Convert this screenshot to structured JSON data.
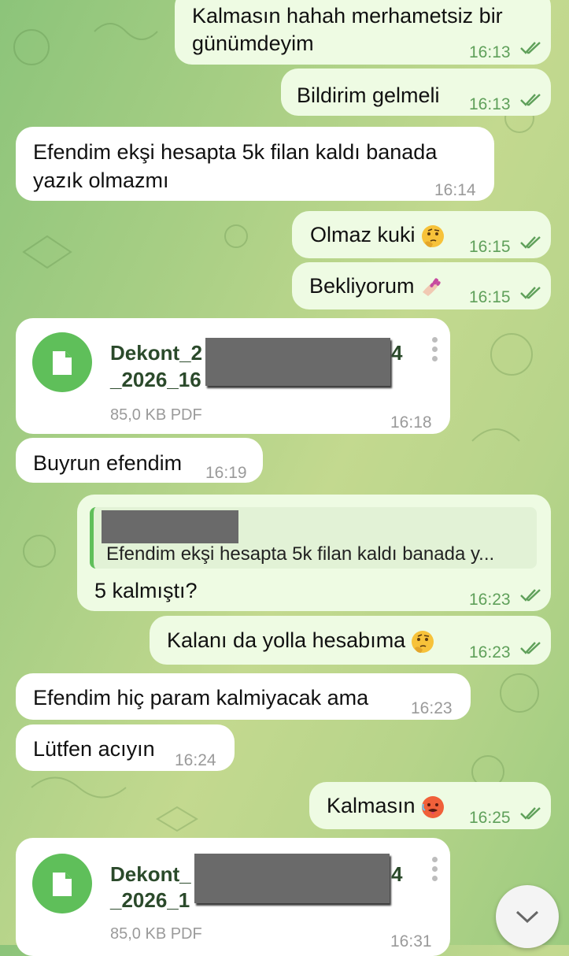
{
  "colors": {
    "outgoing_bubble": "#eefbe3",
    "incoming_bubble": "#ffffff",
    "accent": "#5fbf5a"
  },
  "messages": [
    {
      "dir": "out",
      "lines": [
        "Kalmasın hahah merhametsiz bir",
        "günümdeyim"
      ],
      "time": "16:13",
      "read": true
    },
    {
      "dir": "out",
      "lines": [
        "Bildirim gelmeli"
      ],
      "time": "16:13",
      "read": true
    },
    {
      "dir": "in",
      "lines": [
        "Efendim ekşi hesapta 5k filan kaldı banada",
        "yazık olmazmı"
      ],
      "time": "16:14"
    },
    {
      "dir": "out",
      "lines": [
        "Olmaz kuki"
      ],
      "emoji": "thinking-face",
      "time": "16:15",
      "read": true
    },
    {
      "dir": "out",
      "lines": [
        "Bekliyorum"
      ],
      "emoji": "nail-polish",
      "time": "16:15",
      "read": true
    },
    {
      "dir": "in",
      "type": "file",
      "name_line1": "Dekont_2",
      "name_line1_end": "4",
      "name_line2": "_2026_16",
      "size": "85,0 KB PDF",
      "time": "16:18"
    },
    {
      "dir": "in",
      "lines": [
        "Buyrun efendim"
      ],
      "time": "16:19"
    },
    {
      "dir": "out",
      "reply_text": "Efendim ekşi hesapta 5k filan kaldı banada y...",
      "lines": [
        "5 kalmıştı?"
      ],
      "time": "16:23",
      "read": true
    },
    {
      "dir": "out",
      "lines": [
        "Kalanı da yolla hesabıma"
      ],
      "emoji": "thinking-face",
      "time": "16:23",
      "read": true
    },
    {
      "dir": "in",
      "lines": [
        "Efendim hiç param kalmiyacak ama"
      ],
      "time": "16:23"
    },
    {
      "dir": "in",
      "lines": [
        "Lütfen acıyın"
      ],
      "time": "16:24"
    },
    {
      "dir": "out",
      "lines": [
        "Kalmasın"
      ],
      "emoji": "hot-face",
      "time": "16:25",
      "read": true
    },
    {
      "dir": "in",
      "type": "file",
      "name_line1": "Dekont_",
      "name_line1_end": "4",
      "name_line2": "_2026_1",
      "size": "85,0 KB PDF",
      "time": "16:31"
    }
  ],
  "scroll_down_icon": "chevron-down-icon"
}
